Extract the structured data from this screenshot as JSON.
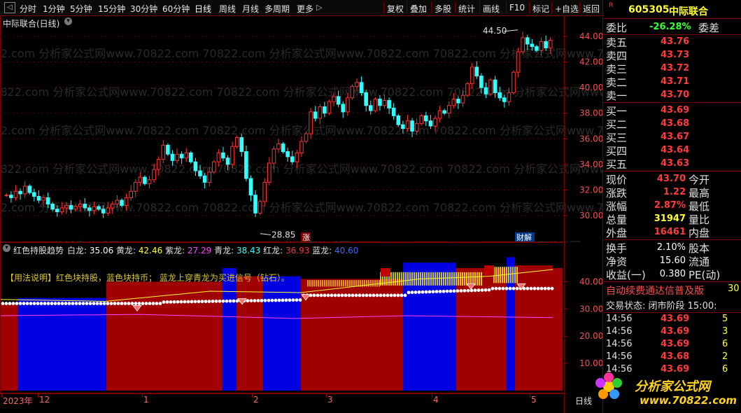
{
  "toolbar": {
    "tabs": [
      "分时",
      "1分钟",
      "5分钟",
      "15分钟",
      "30分钟",
      "60分钟",
      "日线",
      "周线",
      "月线",
      "多周期",
      "更多"
    ],
    "active_tab": "日线",
    "more_arrow": "▷",
    "right_buttons": [
      "复权",
      "叠加",
      "多股",
      "统计",
      "画线",
      "F10",
      "标记",
      "+自选",
      "返回"
    ]
  },
  "chart": {
    "title": "中际联合(日线)",
    "y_ticks": [
      "44.00",
      "42.00",
      "40.00",
      "38.00",
      "36.00",
      "34.00",
      "32.00",
      "30.00"
    ],
    "high_marker": "44.50",
    "low_marker": "28.85",
    "badge_zhang": "涨",
    "badge_caijie": "财解",
    "watermark": "70822.com 分析家公式网www.70822.com"
  },
  "indicator": {
    "name": "红色持股趋势",
    "values": [
      {
        "label": "白龙:",
        "value": "35.06",
        "color": "#ffffff"
      },
      {
        "label": "黄龙:",
        "value": "42.46",
        "color": "#ffff33"
      },
      {
        "label": "紫龙:",
        "value": "27.29",
        "color": "#ff44ff"
      },
      {
        "label": "青龙:",
        "value": "38.43",
        "color": "#33ffff"
      },
      {
        "label": "红龙:",
        "value": "36.93",
        "color": "#ff3333"
      },
      {
        "label": "蓝龙:",
        "value": "40.60",
        "color": "#4466ff"
      }
    ],
    "usage_note": "【用法说明】红色块持股，蓝色块持币； 蓝龙上穿青龙为买进信号（钻石）。",
    "y_ticks": [
      "40.00",
      "30.00",
      "20.00",
      "10.00"
    ]
  },
  "date_axis": {
    "labels": [
      "2023年",
      "12",
      "1",
      "2",
      "3",
      "4",
      "5"
    ],
    "period": "日线"
  },
  "panel": {
    "code": "605305",
    "name": "中际联合",
    "r_mark": "R",
    "webi_label": "委比",
    "webi_value": "-26.28%",
    "weicha_label": "委差",
    "asks": [
      {
        "label": "卖五",
        "price": "43.76"
      },
      {
        "label": "卖四",
        "price": "43.73"
      },
      {
        "label": "卖三",
        "price": "43.72"
      },
      {
        "label": "卖二",
        "price": "43.71"
      },
      {
        "label": "卖一",
        "price": "43.70"
      }
    ],
    "bids": [
      {
        "label": "买一",
        "price": "43.69"
      },
      {
        "label": "买二",
        "price": "43.68"
      },
      {
        "label": "买三",
        "price": "43.67"
      },
      {
        "label": "买四",
        "price": "43.64"
      },
      {
        "label": "买五",
        "price": "43.63"
      }
    ],
    "stats": [
      {
        "label": "现价",
        "value": "43.70",
        "right": "今开",
        "color": "red"
      },
      {
        "label": "涨跌",
        "value": "1.22",
        "right": "最高",
        "color": "red"
      },
      {
        "label": "涨幅",
        "value": "2.87%",
        "right": "最低",
        "color": "red"
      },
      {
        "label": "总量",
        "value": "31947",
        "right": "量比",
        "color": "yel"
      },
      {
        "label": "外盘",
        "value": "16461",
        "right": "内盘",
        "color": "red"
      }
    ],
    "stats2": [
      {
        "label": "换手",
        "value": "2.10%",
        "right": "股本"
      },
      {
        "label": "净资",
        "value": "15.60",
        "right": "流通"
      },
      {
        "label": "收益(一)",
        "value": "0.380",
        "right": "PE(动)"
      }
    ],
    "promo": "自动续费通达信普及版",
    "promo_num": "30",
    "trade_status": "交易状态: 闭市阶段 15:00:",
    "ticks": [
      {
        "time": "14:56",
        "price": "43.69",
        "vol": "5"
      },
      {
        "time": "14:56",
        "price": "43.69",
        "vol": "3"
      },
      {
        "time": "14:56",
        "price": "43.69",
        "vol": "6"
      },
      {
        "time": "14:56",
        "price": "43.68",
        "vol": "2"
      },
      {
        "time": "14:56",
        "price": "43.69",
        "vol": "6"
      }
    ],
    "logo_text": "分析家公式网",
    "logo_url": "www.70822.com"
  },
  "colors": {
    "up": "#ff3333",
    "down": "#33ffff",
    "hold_block": "#a00000",
    "cash_block": "#0000e0",
    "frame": "#7a0000"
  }
}
